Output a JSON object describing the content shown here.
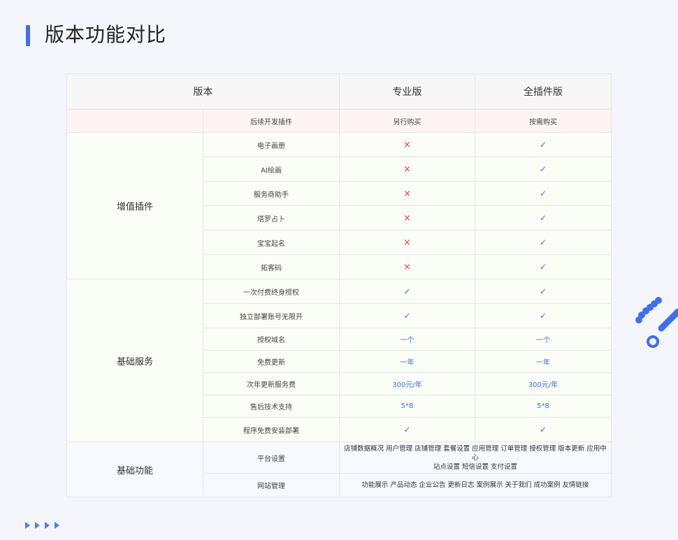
{
  "page": {
    "title": "版本功能对比"
  },
  "table": {
    "headers": [
      "版本",
      "专业版",
      "全插件版"
    ],
    "later_plugins": {
      "label": "后续开发插件",
      "pro": "另行购买",
      "full": "按需购买"
    },
    "groups": [
      {
        "label": "增值插件",
        "rows": [
          {
            "feature": "电子画册",
            "pro": "cross",
            "full": "check"
          },
          {
            "feature": "AI绘画",
            "pro": "cross",
            "full": "check"
          },
          {
            "feature": "服务商助手",
            "pro": "cross",
            "full": "check"
          },
          {
            "feature": "塔罗占卜",
            "pro": "cross",
            "full": "check"
          },
          {
            "feature": "宝宝起名",
            "pro": "cross",
            "full": "check"
          },
          {
            "feature": "拓客码",
            "pro": "cross",
            "full": "check"
          }
        ]
      },
      {
        "label": "基础服务",
        "rows": [
          {
            "feature": "一次付费终身授权",
            "pro": "check",
            "full": "check"
          },
          {
            "feature": "独立部署账号无限开",
            "pro": "check",
            "full": "check"
          },
          {
            "feature": "授权域名",
            "pro": "一个",
            "full": "一个"
          },
          {
            "feature": "免费更新",
            "pro": "一年",
            "full": "一年"
          },
          {
            "feature": "次年更新服务费",
            "pro": "300元/年",
            "full": "300元/年"
          },
          {
            "feature": "售后技术支持",
            "pro": "5*8",
            "full": "5*8"
          },
          {
            "feature": "程序免费安装部署",
            "pro": "check",
            "full": "check"
          }
        ]
      },
      {
        "label": "基础功能",
        "rows": [
          {
            "feature": "平台设置",
            "desc_line1": "店铺数据概况 用户管理 店铺管理 套餐设置 应用管理 订单管理 授权管理 版本更新 应用中心",
            "desc_line2": "站点设置 短信设置 支付设置"
          },
          {
            "feature": "网站管理",
            "desc_line1": "功能展示 产品动态 企业公告 更新日志 案例展示 关于我们 成功案例 友情链接"
          }
        ]
      }
    ]
  },
  "icons": {
    "cross": "×",
    "check": "✓"
  },
  "colors": {
    "accent": "#3d6ff5",
    "cross": "#e0423f",
    "check": "#3a6fd8"
  }
}
